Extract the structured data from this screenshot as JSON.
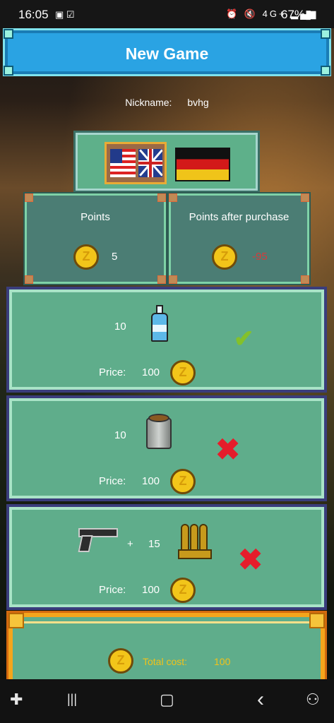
{
  "status_bar": {
    "time": "16:05",
    "left_icons": "▣ ☑",
    "right_icons": "⏰ 🔇 4G+ ▂▄▆",
    "battery": "67%▮"
  },
  "header": {
    "title": "New Game"
  },
  "nickname": {
    "label": "Nickname:",
    "value": "bvhg"
  },
  "language": {
    "options": [
      "en",
      "de"
    ]
  },
  "points": {
    "current_label": "Points",
    "current_value": "5",
    "after_label": "Points after purchase",
    "after_value": "-95"
  },
  "items": [
    {
      "name": "water",
      "quantity": "10",
      "price_label": "Price:",
      "price": "100",
      "status": "✔"
    },
    {
      "name": "food-can",
      "quantity": "10",
      "price_label": "Price:",
      "price": "100",
      "status": "✖"
    },
    {
      "name": "pistol-ammo",
      "plus": "+",
      "quantity": "15",
      "price_label": "Price:",
      "price": "100",
      "status": "✖"
    }
  ],
  "total": {
    "label": "Total cost:",
    "value": "100"
  },
  "coin_glyph": "Z",
  "nav_bar": {
    "game": "✚",
    "recents": "|||",
    "home": "▢",
    "back": "‹",
    "assist": "⚇"
  },
  "colors": {
    "header": "#2aa3e3",
    "panel": "#5fad8b",
    "coin": "#f2c51a",
    "negative": "#d63b3b",
    "gold_text": "#f1c21a"
  }
}
